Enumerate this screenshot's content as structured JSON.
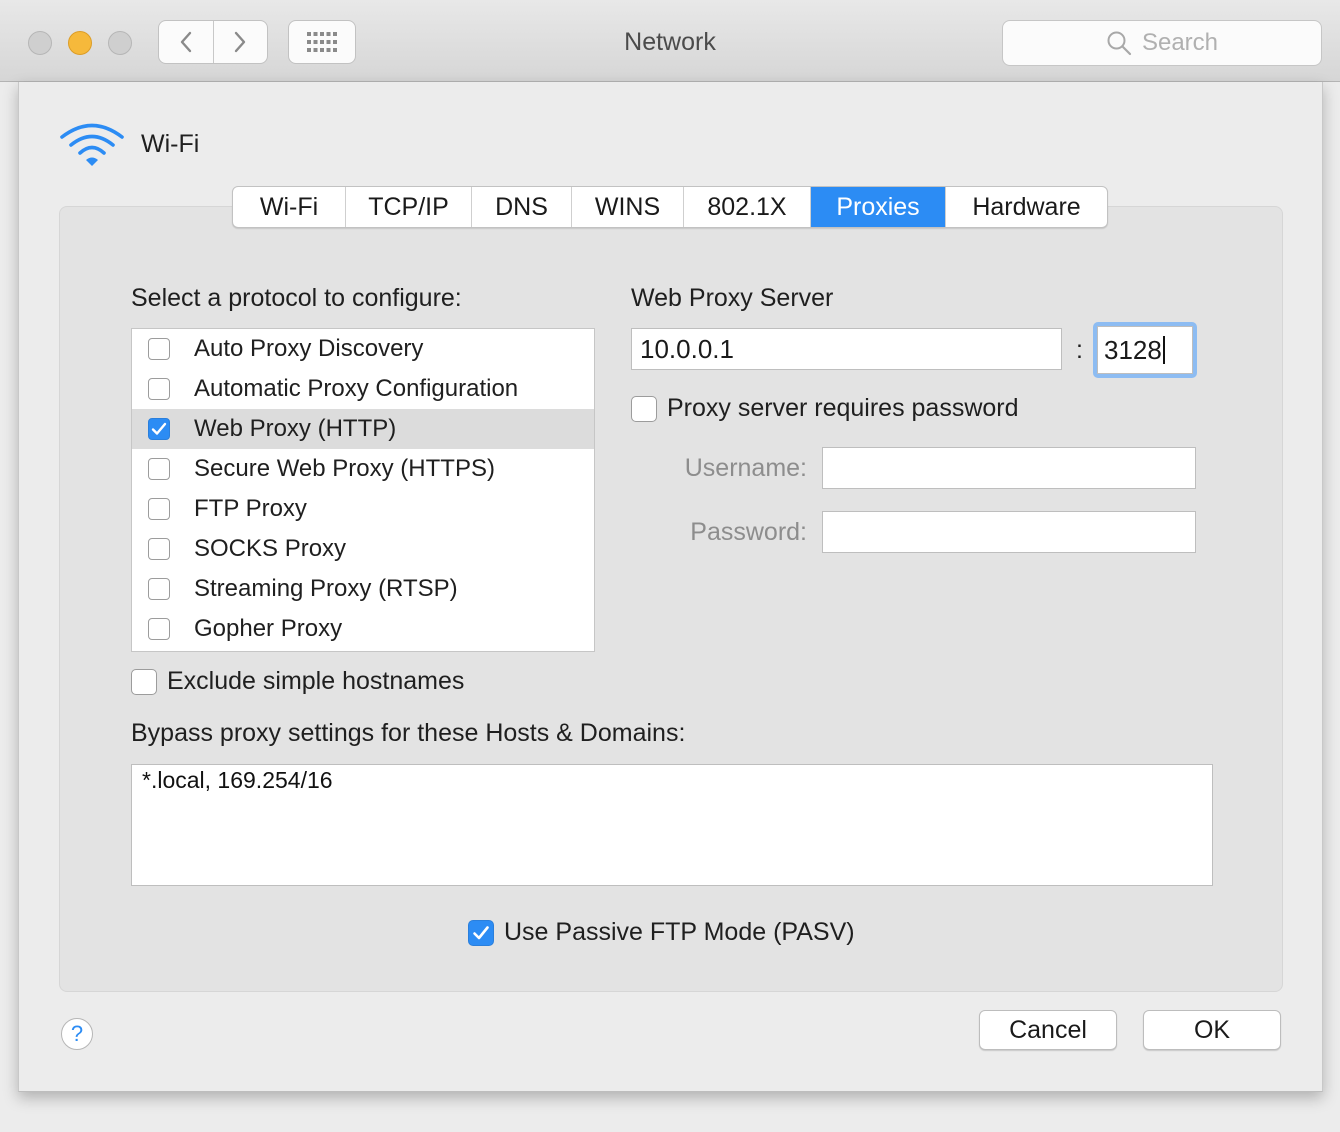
{
  "window": {
    "title": "Network"
  },
  "toolbar": {
    "search_placeholder": "Search"
  },
  "colors": {
    "accent": "#2c8cf4",
    "minimize": "#f6b93b"
  },
  "header": {
    "interface_name": "Wi-Fi"
  },
  "tabs": [
    {
      "label": "Wi-Fi",
      "active": false
    },
    {
      "label": "TCP/IP",
      "active": false
    },
    {
      "label": "DNS",
      "active": false
    },
    {
      "label": "WINS",
      "active": false
    },
    {
      "label": "802.1X",
      "active": false
    },
    {
      "label": "Proxies",
      "active": true
    },
    {
      "label": "Hardware",
      "active": false
    }
  ],
  "protocols": {
    "heading": "Select a protocol to configure:",
    "items": [
      {
        "label": "Auto Proxy Discovery",
        "checked": false
      },
      {
        "label": "Automatic Proxy Configuration",
        "checked": false
      },
      {
        "label": "Web Proxy (HTTP)",
        "checked": true,
        "selected": true
      },
      {
        "label": "Secure Web Proxy (HTTPS)",
        "checked": false
      },
      {
        "label": "FTP Proxy",
        "checked": false
      },
      {
        "label": "SOCKS Proxy",
        "checked": false
      },
      {
        "label": "Streaming Proxy (RTSP)",
        "checked": false
      },
      {
        "label": "Gopher Proxy",
        "checked": false
      }
    ]
  },
  "proxy_server": {
    "heading": "Web Proxy Server",
    "address": "10.0.0.1",
    "separator": ":",
    "port": "3128",
    "requires_password_label": "Proxy server requires password",
    "requires_password": false,
    "username_label": "Username:",
    "username": "",
    "password_label": "Password:",
    "password": ""
  },
  "exclude_simple_hostnames": {
    "label": "Exclude simple hostnames",
    "checked": false
  },
  "bypass": {
    "label": "Bypass proxy settings for these Hosts & Domains:",
    "value": "*.local, 169.254/16"
  },
  "passive_ftp": {
    "label": "Use Passive FTP Mode (PASV)",
    "checked": true
  },
  "footer": {
    "help_label": "?",
    "cancel_label": "Cancel",
    "ok_label": "OK"
  }
}
